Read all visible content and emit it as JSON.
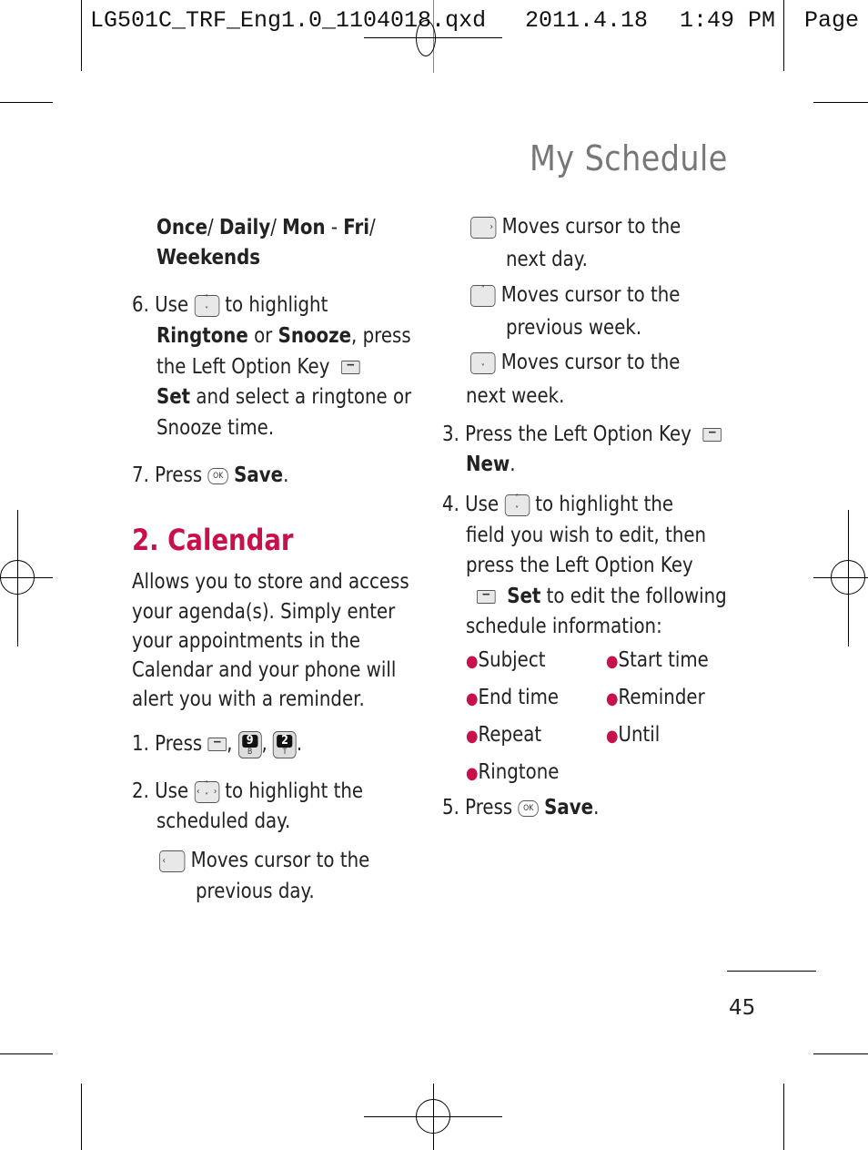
{
  "slug": {
    "filename": "LG501C_TRF_Eng1.0_1104018.qxd",
    "date": "2011.4.18",
    "time": "1:49 PM",
    "page_label": "Page"
  },
  "page_title": "My Schedule",
  "accent_color": "#c8104a",
  "left_column": {
    "repeat_options": {
      "opt1": "Once",
      "opt2": "Daily",
      "opt3": "Mon",
      "opt4": "Fri",
      "opt5": "Weekends",
      "sep": "/ ",
      "dash": " - "
    },
    "step6": {
      "num": "6. Use",
      "t1": "to highlight",
      "ringtone": "Ringtone",
      "or": " or ",
      "snooze": "Snooze",
      "t2": ", press",
      "t3": "the Left Option Key",
      "set": "Set",
      "t4": " and select a ringtone or",
      "t5": "Snooze time."
    },
    "step7": {
      "num": "7. Press",
      "save": "Save",
      "period": "."
    },
    "section_heading": "2. Calendar",
    "intro": [
      "Allows you to store and access",
      "your agenda(s). Simply enter",
      "your appointments in the",
      "Calendar and your phone will",
      "alert you with a reminder."
    ],
    "cal_step1": {
      "num": "1. Press",
      "comma": ",",
      "period": ".",
      "key2_digit": "9",
      "key2_letter": "B",
      "key3_digit": "2",
      "key3_letter": "T"
    },
    "cal_step2": {
      "num": "2. Use",
      "t1": "to highlight the",
      "t2": "scheduled day."
    },
    "left_key": {
      "glyph": "‹",
      "l1": "Moves cursor to the",
      "l2": "previous day."
    }
  },
  "right_column": {
    "right_key": {
      "glyph": "›",
      "l1": "Moves cursor to the",
      "l2": "next day."
    },
    "up_key": {
      "glyph": "˄",
      "l1": "Moves cursor to the",
      "l2": "previous week."
    },
    "down_key": {
      "glyph": "˅",
      "l1": "Moves cursor to the",
      "l2": "next week."
    },
    "step3": {
      "t1": "3. Press the Left Option Key",
      "new": "New",
      "period": "."
    },
    "step4": {
      "num": "4. Use",
      "t1": "to highlight the",
      "t2": "field you wish to edit, then",
      "t3": "press the Left Option Key",
      "set": "Set",
      "t4": " to edit the following",
      "t5": "schedule information:"
    },
    "fields": [
      "Subject",
      "Start time",
      "End time",
      "Reminder",
      "Repeat",
      "Until",
      "Ringtone"
    ],
    "step5": {
      "num": "5. Press",
      "save": "Save",
      "period": "."
    }
  },
  "icons": {
    "ok_label": "OK",
    "minus": "−",
    "bullet": "●",
    "nav_up": "˄",
    "nav_down": "˅",
    "nav_left": "‹",
    "nav_right": "›"
  },
  "page_number": "45"
}
